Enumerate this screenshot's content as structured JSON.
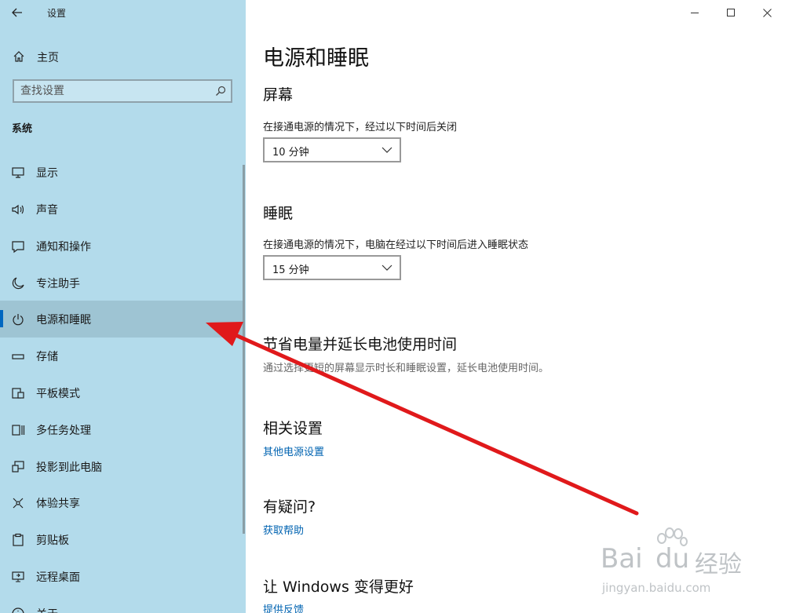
{
  "window": {
    "title": "设置"
  },
  "sidebar": {
    "home_label": "主页",
    "search_placeholder": "查找设置",
    "section_title": "系统",
    "items": [
      {
        "label": "显示",
        "icon": "monitor-icon"
      },
      {
        "label": "声音",
        "icon": "speaker-icon"
      },
      {
        "label": "通知和操作",
        "icon": "notification-icon"
      },
      {
        "label": "专注助手",
        "icon": "moon-icon"
      },
      {
        "label": "电源和睡眠",
        "icon": "power-icon",
        "active": true
      },
      {
        "label": "存储",
        "icon": "storage-icon"
      },
      {
        "label": "平板模式",
        "icon": "tablet-icon"
      },
      {
        "label": "多任务处理",
        "icon": "multitask-icon"
      },
      {
        "label": "投影到此电脑",
        "icon": "project-icon"
      },
      {
        "label": "体验共享",
        "icon": "share-icon"
      },
      {
        "label": "剪贴板",
        "icon": "clipboard-icon"
      },
      {
        "label": "远程桌面",
        "icon": "remote-desktop-icon"
      },
      {
        "label": "关于",
        "icon": "info-icon"
      }
    ]
  },
  "main": {
    "page_title": "电源和睡眠",
    "screen": {
      "heading": "屏幕",
      "description": "在接通电源的情况下，经过以下时间后关闭",
      "value": "10 分钟"
    },
    "sleep": {
      "heading": "睡眠",
      "description": "在接通电源的情况下，电脑在经过以下时间后进入睡眠状态",
      "value": "15 分钟"
    },
    "battery": {
      "heading": "节省电量并延长电池使用时间",
      "description": "通过选择更短的屏幕显示时长和睡眠设置，延长电池使用时间。"
    },
    "related": {
      "heading": "相关设置",
      "link": "其他电源设置"
    },
    "question": {
      "heading": "有疑问?",
      "link": "获取帮助"
    },
    "feedback": {
      "heading": "让 Windows 变得更好",
      "link": "提供反馈"
    }
  },
  "watermark": {
    "brand": "Bai",
    "brand2": "du",
    "cn": "经验",
    "url": "jingyan.baidu.com"
  },
  "colors": {
    "sidebar_bg": "#b3dbeb",
    "active_bg": "#9ec4d3",
    "accent": "#0067c0",
    "link": "#0063b1",
    "annotation_arrow": "#e0191b"
  }
}
